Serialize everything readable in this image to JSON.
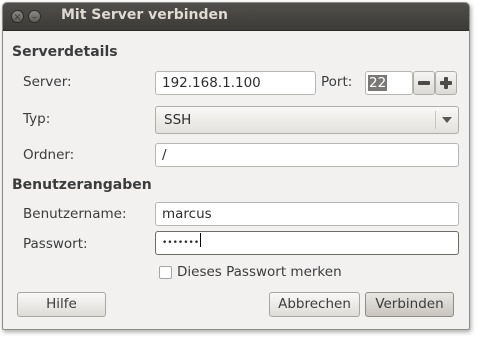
{
  "window": {
    "title": "Mit Server verbinden",
    "close_glyph": "×",
    "minimize_glyph": "–"
  },
  "server_details": {
    "heading": "Serverdetails",
    "server_label": "Server:",
    "server_value": "192.168.1.100",
    "port_label": "Port:",
    "port_value": "22",
    "type_label": "Typ:",
    "type_value": "SSH",
    "folder_label": "Ordner:",
    "folder_value": "/"
  },
  "user_details": {
    "heading": "Benutzerangaben",
    "username_label": "Benutzername:",
    "username_value": "marcus",
    "password_label": "Passwort:",
    "password_value": "•••••••",
    "remember_label": "Dieses Passwort merken",
    "remember_checked": false
  },
  "buttons": {
    "help": "Hilfe",
    "cancel": "Abbrechen",
    "connect": "Verbinden"
  },
  "colors": {
    "titlebar": "#3c3b37",
    "title_text": "#dfdbd2",
    "dialog_bg": "#f2f1f0"
  }
}
